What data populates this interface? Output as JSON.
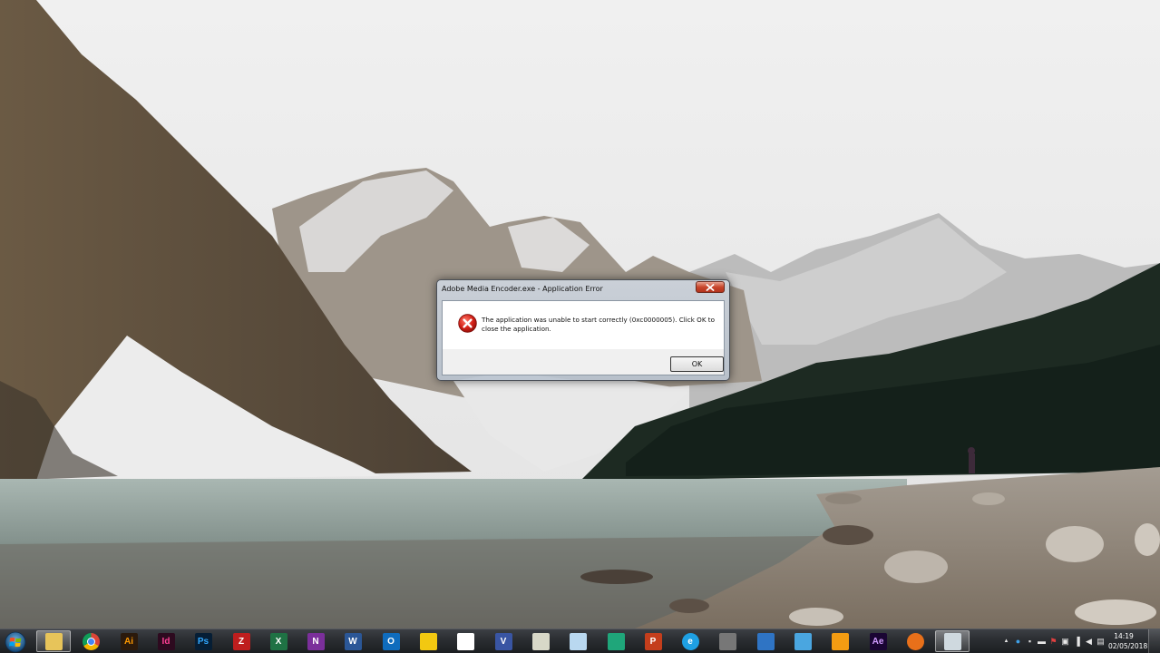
{
  "dialog": {
    "title": "Adobe Media Encoder.exe - Application Error",
    "message": "The application was unable to start correctly (0xc0000005). Click OK to close the application.",
    "ok_label": "OK",
    "icon": "error-icon"
  },
  "taskbar": {
    "start_icon": "windows-logo-icon",
    "apps": [
      {
        "name": "file-explorer",
        "label": "",
        "bg": "#e7c45a",
        "fg": "#6b4a10",
        "active": true
      },
      {
        "name": "chrome",
        "label": "",
        "bg": "#e8e8e8",
        "fg": "#333",
        "active": false
      },
      {
        "name": "illustrator",
        "label": "Ai",
        "bg": "#2b1a0c",
        "fg": "#ff9a00",
        "active": false
      },
      {
        "name": "indesign",
        "label": "Id",
        "bg": "#2d0a1f",
        "fg": "#ff3f94",
        "active": false
      },
      {
        "name": "photoshop",
        "label": "Ps",
        "bg": "#061e35",
        "fg": "#31a8ff",
        "active": false
      },
      {
        "name": "filezilla",
        "label": "Z",
        "bg": "#bf1e1e",
        "fg": "#ffffff",
        "active": false
      },
      {
        "name": "excel",
        "label": "X",
        "bg": "#1f7244",
        "fg": "#ffffff",
        "active": false
      },
      {
        "name": "onenote",
        "label": "N",
        "bg": "#7b2f9b",
        "fg": "#ffffff",
        "active": false
      },
      {
        "name": "word",
        "label": "W",
        "bg": "#2b5797",
        "fg": "#ffffff",
        "active": false
      },
      {
        "name": "outlook",
        "label": "O",
        "bg": "#0f6cbd",
        "fg": "#ffffff",
        "active": false
      },
      {
        "name": "power-bi",
        "label": "",
        "bg": "#f2c811",
        "fg": "#333",
        "active": false
      },
      {
        "name": "analytics-app",
        "label": "",
        "bg": "#ffffff",
        "fg": "#1e4d9a",
        "active": false
      },
      {
        "name": "visio",
        "label": "V",
        "bg": "#3955a3",
        "fg": "#ffffff",
        "active": false
      },
      {
        "name": "keepass",
        "label": "",
        "bg": "#d8d8c8",
        "fg": "#444",
        "active": false
      },
      {
        "name": "notepad",
        "label": "",
        "bg": "#b9d8f0",
        "fg": "#2b5797",
        "active": false
      },
      {
        "name": "green-app",
        "label": "",
        "bg": "#1fa67a",
        "fg": "#ffffff",
        "active": false
      },
      {
        "name": "powerpoint",
        "label": "P",
        "bg": "#c43e1c",
        "fg": "#ffffff",
        "active": false
      },
      {
        "name": "internet-explorer",
        "label": "e",
        "bg": "#1ea0e3",
        "fg": "#ffffff",
        "active": false
      },
      {
        "name": "network-app",
        "label": "",
        "bg": "#777777",
        "fg": "#ffffff",
        "active": false
      },
      {
        "name": "remote-desktop",
        "label": "",
        "bg": "#2f74c4",
        "fg": "#ffffff",
        "active": false
      },
      {
        "name": "cube-app",
        "label": "",
        "bg": "#4aa6e0",
        "fg": "#ffffff",
        "active": false
      },
      {
        "name": "pen-app",
        "label": "",
        "bg": "#f39c12",
        "fg": "#ffffff",
        "active": false
      },
      {
        "name": "after-effects",
        "label": "Ae",
        "bg": "#1a0533",
        "fg": "#d19cff",
        "active": false
      },
      {
        "name": "orange-app",
        "label": "",
        "bg": "#e8701a",
        "fg": "#ffffff",
        "active": false
      },
      {
        "name": "window-app",
        "label": "",
        "bg": "#cfd9df",
        "fg": "#2b6c7a",
        "active": true
      }
    ],
    "tray": {
      "icons": [
        "show-hidden-arrow-icon",
        "network-globe-icon",
        "usb-icon",
        "chat-icon",
        "shield-flag-icon",
        "photo-icon",
        "signal-bars-icon",
        "volume-icon",
        "keyboard-icon"
      ],
      "time": "14:19",
      "date": "02/05/2018"
    }
  }
}
